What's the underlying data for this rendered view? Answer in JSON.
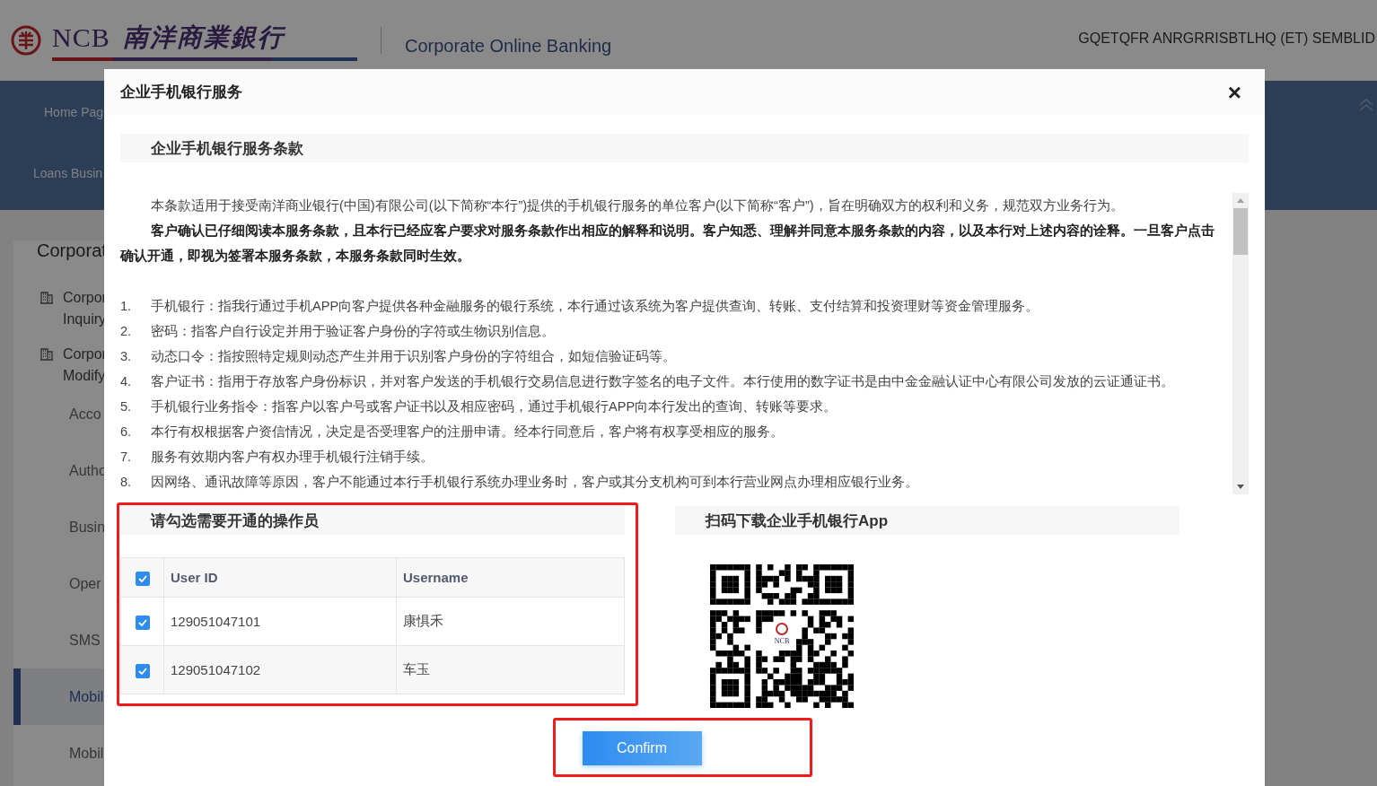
{
  "header": {
    "logo_mark": "NCB",
    "logo_name": "南洋商業銀行",
    "product": "Corporate Online Banking",
    "user": "GQETQFR ANRGRRISBTLHQ (ET) SEMBLID"
  },
  "nav": {
    "items": [
      "Home Pag",
      "Loans Busin"
    ]
  },
  "sidebar": {
    "title": "Corporat",
    "items": [
      {
        "kind": "group",
        "lines": [
          "Corpor",
          "Inquiry"
        ],
        "selected": false
      },
      {
        "kind": "group",
        "lines": [
          "Corpor",
          "Modify"
        ],
        "selected": false
      },
      {
        "kind": "item",
        "lines": [
          "Acco"
        ],
        "selected": false
      },
      {
        "kind": "item",
        "lines": [
          "Autho"
        ],
        "selected": false
      },
      {
        "kind": "item",
        "lines": [
          "Busin"
        ],
        "selected": false
      },
      {
        "kind": "item",
        "lines": [
          "Oper"
        ],
        "selected": false
      },
      {
        "kind": "item",
        "lines": [
          "SMS"
        ],
        "selected": false
      },
      {
        "kind": "item",
        "lines": [
          "Mobil"
        ],
        "selected": true
      },
      {
        "kind": "item",
        "lines": [
          "Mobil"
        ],
        "selected": false
      }
    ]
  },
  "modal": {
    "title": "企业手机银行服务",
    "close": "×",
    "terms": {
      "title": "企业手机银行服务条款",
      "paragraphs": [
        {
          "kind": "normal",
          "text": "本条款适用于接受南洋商业银行(中国)有限公司(以下简称“本行”)提供的手机银行服务的单位客户(以下简称“客户”)，旨在明确双方的权利和义务，规范双方业务行为。"
        },
        {
          "kind": "bold",
          "text": "客户确认已仔细阅读本服务条款，且本行已经应客户要求对服务条款作出相应的解释和说明。客户知悉、理解并同意本服务条款的内容，以及本行对上述内容的诠释。一旦客户点击确认开通，即视为签署本服务条款，本服务条款同时生效。"
        }
      ],
      "items": [
        {
          "number": "1.",
          "text": "手机银行：指我行通过手机APP向客户提供各种金融服务的银行系统，本行通过该系统为客户提供查询、转账、支付结算和投资理财等资金管理服务。"
        },
        {
          "number": "2.",
          "text": "密码：指客户自行设定并用于验证客户身份的字符或生物识别信息。"
        },
        {
          "number": "3.",
          "text": "动态口令：指按照特定规则动态产生并用于识别客户身份的字符组合，如短信验证码等。"
        },
        {
          "number": "4.",
          "text": "客户证书：指用于存放客户身份标识，并对客户发送的手机银行交易信息进行数字签名的电子文件。本行使用的数字证书是由中金金融认证中心有限公司发放的云证通证书。"
        },
        {
          "number": "5.",
          "text": "手机银行业务指令：指客户以客户号或客户证书以及相应密码，通过手机银行APP向本行发出的查询、转账等要求。"
        },
        {
          "number": "6.",
          "text": "本行有权根据客户资信情况，决定是否受理客户的注册申请。经本行同意后，客户将有权享受相应的服务。"
        },
        {
          "number": "7.",
          "text": "服务有效期内客户有权办理手机银行注销手续。"
        },
        {
          "number": "8.",
          "text": "因网络、通讯故障等原因，客户不能通过本行手机银行系统办理业务时，客户或其分支机构可到本行营业网点办理相应银行业务。"
        }
      ]
    },
    "operators": {
      "title": "请勾选需要开通的操作员",
      "all_checked": true,
      "columns": [
        "User ID",
        "Username"
      ],
      "rows": [
        {
          "checked": true,
          "user_id": "129051047101",
          "username": "康惧禾"
        },
        {
          "checked": true,
          "user_id": "129051047102",
          "username": "车玉"
        }
      ]
    },
    "download": {
      "title": "扫码下载企业手机银行App",
      "qr_logo": "NCB"
    },
    "confirm": "Confirm"
  }
}
